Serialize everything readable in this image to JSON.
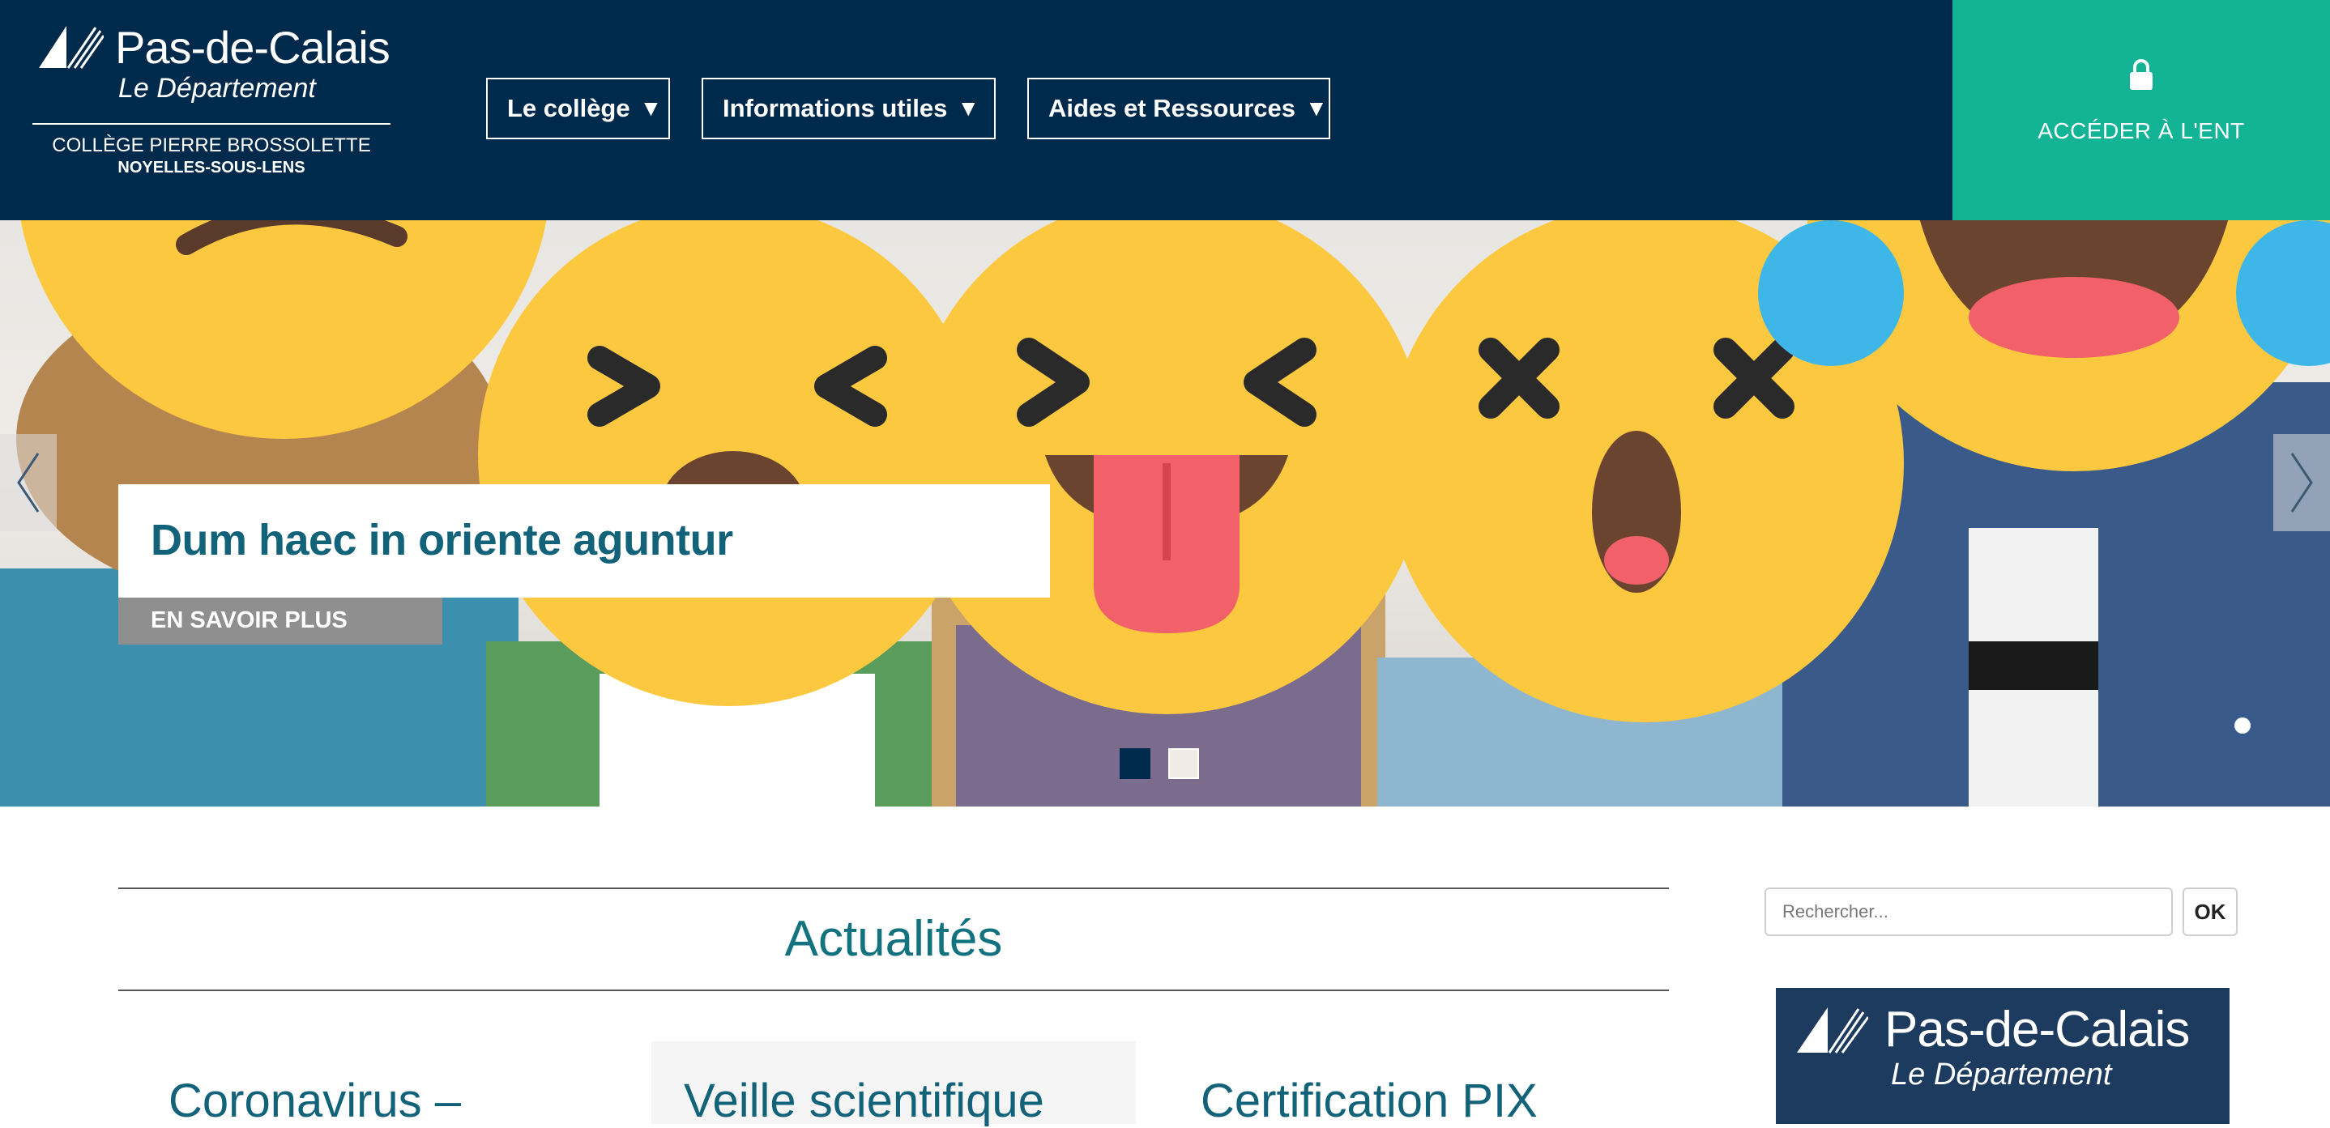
{
  "header": {
    "logo": {
      "name": "Pas-de-Calais",
      "subtitle": "Le Département",
      "school": "COLLÈGE PIERRE BROSSOLETTE",
      "city": "NOYELLES-SOUS-LENS"
    },
    "nav": [
      {
        "label": "Le collège",
        "icon": "caret-down-icon"
      },
      {
        "label": "Informations utiles",
        "icon": "caret-down-icon"
      },
      {
        "label": "Aides et Ressources",
        "icon": "caret-down-icon"
      }
    ],
    "ent": {
      "label": "ACCÉDER À L'ENT",
      "icon": "lock-icon"
    }
  },
  "hero": {
    "slide_title": "Dum haec in oriente aguntur",
    "more_label": "EN SAVOIR PLUS",
    "active_slide": 1,
    "slide_count": 2
  },
  "news": {
    "heading": "Actualités",
    "articles": [
      {
        "title": "Coronavirus –"
      },
      {
        "title": "Veille scientifique"
      },
      {
        "title": "Certification PIX"
      }
    ]
  },
  "sidebar": {
    "search": {
      "placeholder": "Rechercher...",
      "value": "",
      "button_label": "OK"
    },
    "banner": {
      "name": "Pas-de-Calais",
      "subtitle": "Le Département"
    }
  },
  "colors": {
    "header_bg": "#002a4b",
    "ent_bg": "#13b496",
    "title_teal": "#12627a",
    "banner_bg": "#1d3b5f"
  }
}
